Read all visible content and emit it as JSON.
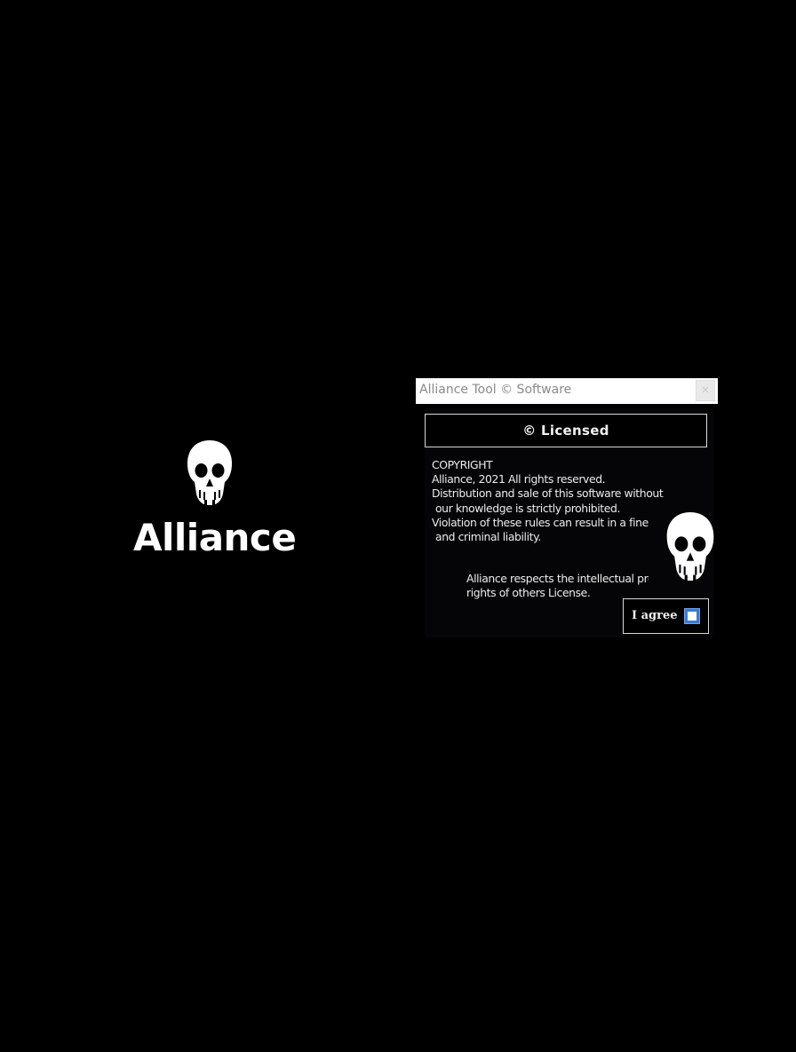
{
  "logo": {
    "icon": "skull-icon",
    "text": "Alliance"
  },
  "window": {
    "title": "Alliance Tool © Software",
    "close_icon": "close-icon",
    "licensed_label": "© Licensed",
    "copyright_lines": [
      "COPYRIGHT",
      "Alliance, 2021 All rights reserved.",
      "Distribution and sale of this software without",
      "our knowledge is strictly prohibited.",
      "Violation of these rules can result in a fine",
      "and criminal liability."
    ],
    "respects_lines": [
      "Alliance respects the intellectual property",
      "rights of others License."
    ],
    "skull_icon": "skull-icon",
    "agree_label": "I agree",
    "agree_checked": false
  },
  "colors": {
    "background": "#000000",
    "text": "#ffffff",
    "checkbox_accent": "#3a7bd5"
  }
}
